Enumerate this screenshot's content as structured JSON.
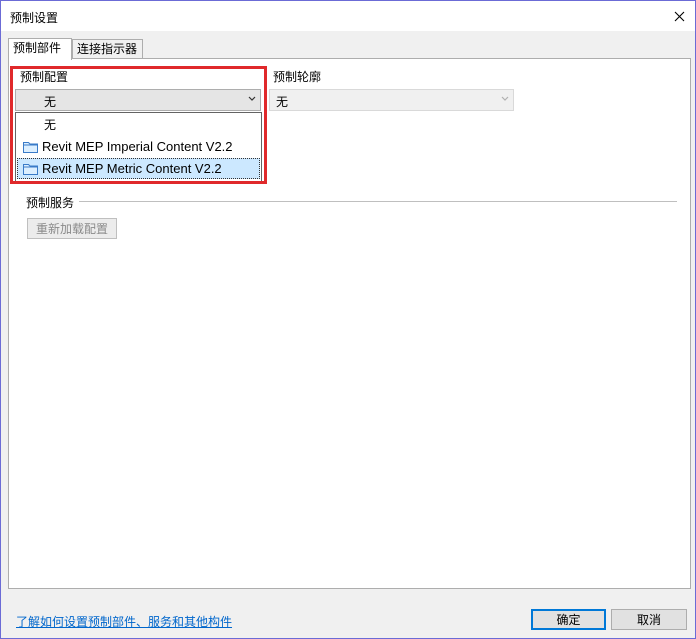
{
  "window": {
    "title": "预制设置",
    "close_icon": "close-icon"
  },
  "tabs": [
    {
      "label": "预制部件",
      "active": true
    },
    {
      "label": "连接指示器",
      "active": false
    }
  ],
  "fab_config": {
    "label": "预制配置",
    "selected": "无",
    "options": [
      {
        "label": "无",
        "icon": ""
      },
      {
        "label": "Revit MEP Imperial Content V2.2",
        "icon": "folder-icon"
      },
      {
        "label": "Revit MEP Metric Content V2.2",
        "icon": "folder-icon",
        "highlighted": true
      }
    ]
  },
  "fab_profile": {
    "label": "预制轮廓",
    "selected": "无"
  },
  "fab_service": {
    "label": "预制服务",
    "reload_button": "重新加载配置"
  },
  "footer": {
    "help_link": "了解如何设置预制部件、服务和其他构件",
    "ok_button": "确定",
    "cancel_button": "取消"
  },
  "colors": {
    "highlight_box": "#e0292b",
    "selection": "#cce8ff",
    "link": "#0066cc",
    "accent": "#0078d7"
  }
}
